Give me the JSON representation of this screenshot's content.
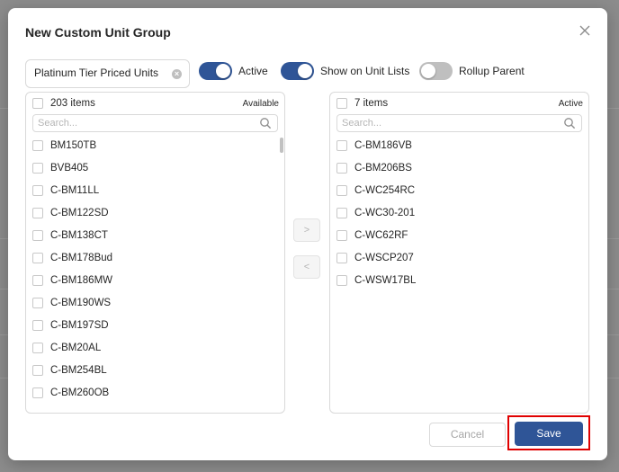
{
  "dialog": {
    "title": "New Custom Unit Group",
    "close_icon": "close-icon"
  },
  "form": {
    "group_name_value": "Platinum Tier Priced Units",
    "clear_icon": "clear-icon",
    "toggles": [
      {
        "label": "Active",
        "on": true
      },
      {
        "label": "Show on Unit Lists",
        "on": true
      },
      {
        "label": "Rollup Parent",
        "on": false
      }
    ]
  },
  "available": {
    "count_label": "203 items",
    "tag": "Available",
    "search_placeholder": "Search...",
    "items": [
      "BM150TB",
      "BVB405",
      "C-BM11LL",
      "C-BM122SD",
      "C-BM138CT",
      "C-BM178Bud",
      "C-BM186MW",
      "C-BM190WS",
      "C-BM197SD",
      "C-BM20AL",
      "C-BM254BL",
      "C-BM260OB"
    ]
  },
  "active": {
    "count_label": "7 items",
    "tag": "Active",
    "search_placeholder": "Search...",
    "items": [
      "C-BM186VB",
      "C-BM206BS",
      "C-WC254RC",
      "C-WC30-201",
      "C-WC62RF",
      "C-WSCP207",
      "C-WSW17BL"
    ]
  },
  "transfer": {
    "move_right": ">",
    "move_left": "<"
  },
  "footer": {
    "cancel_label": "Cancel",
    "save_label": "Save"
  },
  "colors": {
    "primary": "#2f5597",
    "highlight": "#e00000",
    "toggle_off": "#bfbfbf"
  }
}
